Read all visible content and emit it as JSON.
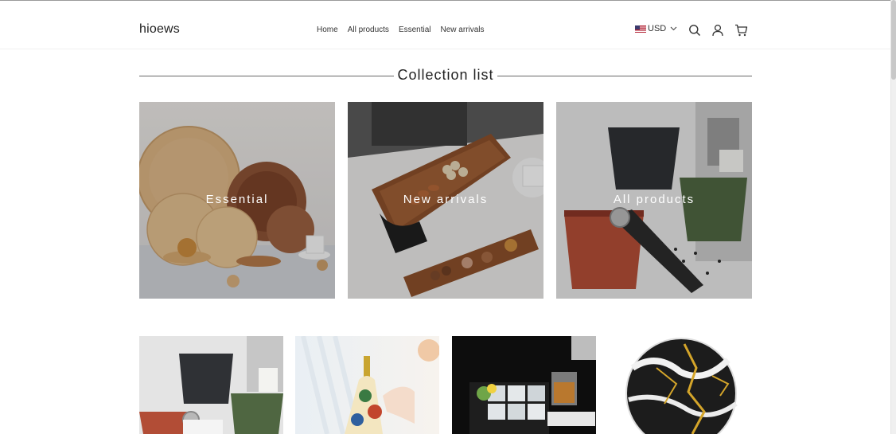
{
  "header": {
    "logo": "hioews",
    "nav": [
      "Home",
      "All products",
      "Essential",
      "New arrivals"
    ],
    "currency": "USD"
  },
  "section": {
    "title": "Collection list"
  },
  "collections": [
    {
      "label": "Essential",
      "image": "wooden-plates"
    },
    {
      "label": "New arrivals",
      "image": "wooden-snack-tray"
    },
    {
      "label": "All products",
      "image": "coffee-knock-boxes"
    }
  ],
  "products": [
    {
      "image": "coffee-knock-boxes"
    },
    {
      "image": "ceramic-oil-bottle"
    },
    {
      "image": "ice-cube-tray"
    },
    {
      "image": "marble-coaster"
    }
  ],
  "icons": [
    "search-icon",
    "account-icon",
    "cart-icon",
    "chevron-down-icon",
    "us-flag-icon"
  ]
}
